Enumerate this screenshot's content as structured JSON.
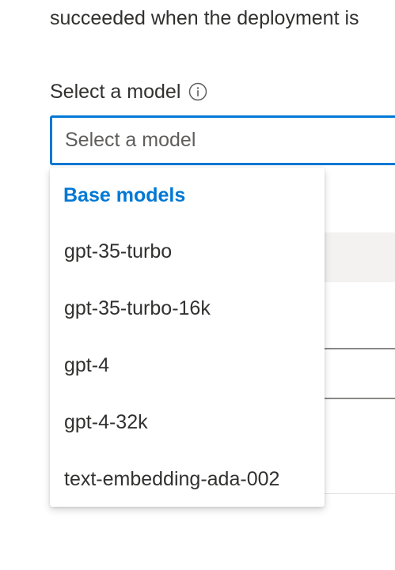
{
  "intro": {
    "text": "succeeded when the deployment is"
  },
  "model_field": {
    "label": "Select a model",
    "info_icon": "info-icon",
    "placeholder": "Select a model",
    "value": ""
  },
  "dropdown": {
    "group_label": "Base models",
    "options": [
      {
        "label": "gpt-35-turbo"
      },
      {
        "label": "gpt-35-turbo-16k"
      },
      {
        "label": "gpt-4"
      },
      {
        "label": "gpt-4-32k"
      },
      {
        "label": "text-embedding-ada-002"
      }
    ]
  },
  "colors": {
    "accent": "#0078d4",
    "text": "#323130",
    "placeholder": "#605e5c"
  }
}
